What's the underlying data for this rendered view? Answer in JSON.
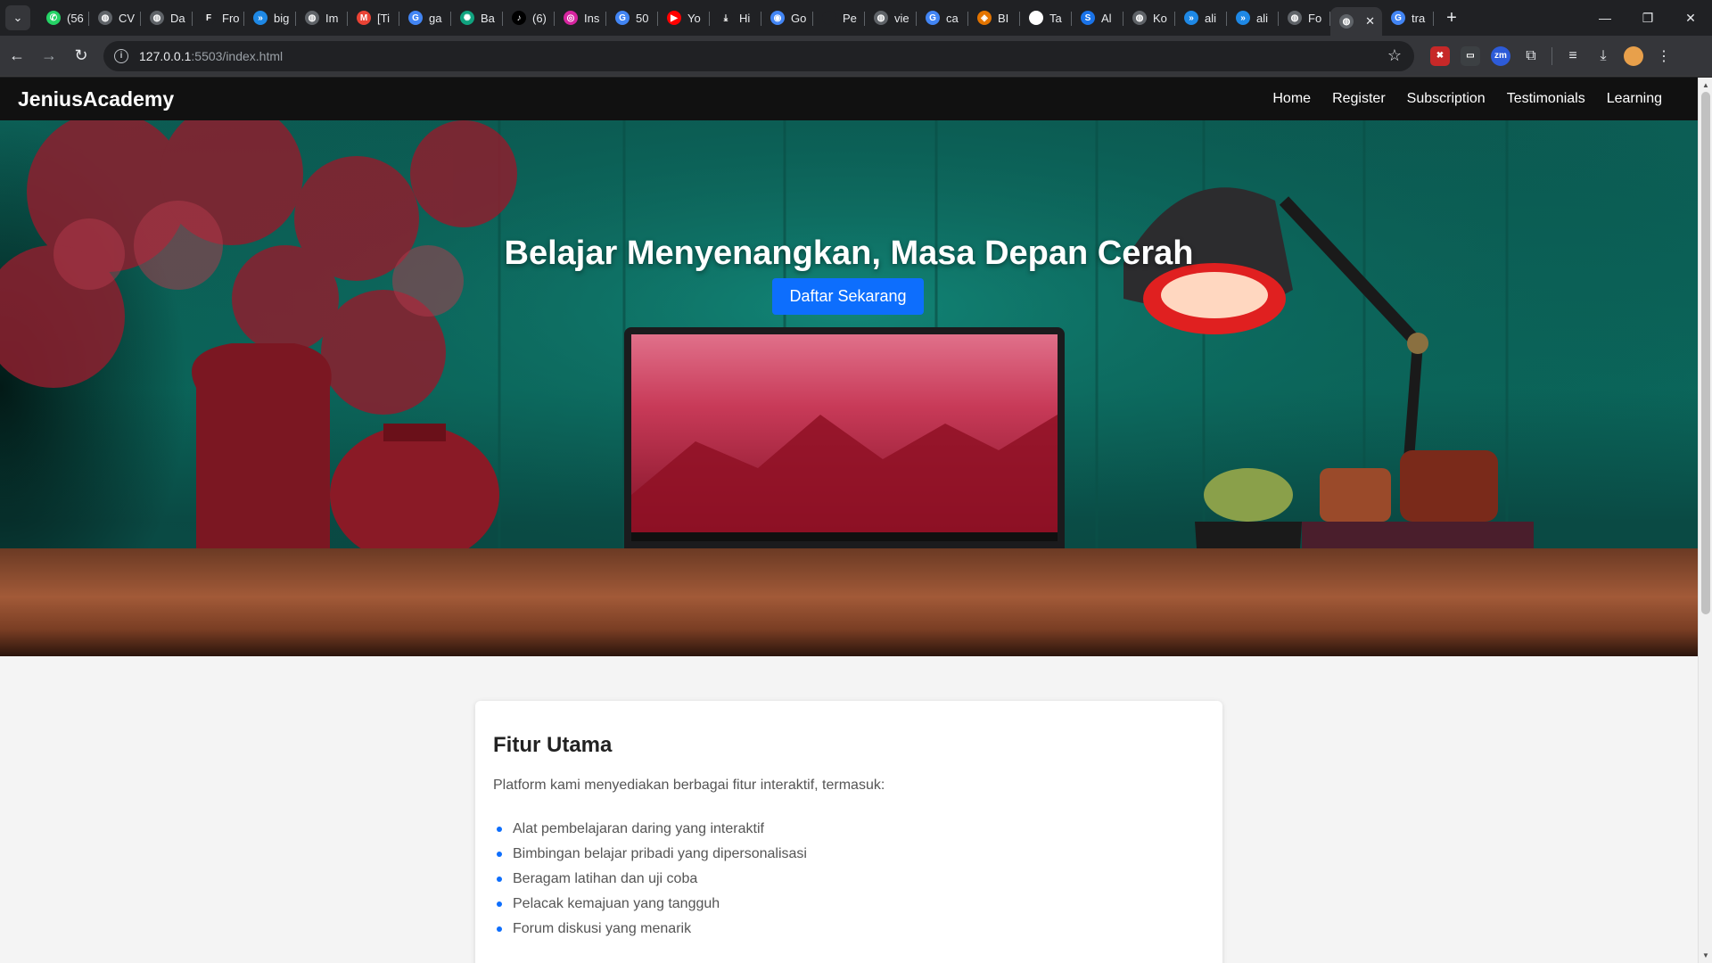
{
  "browser": {
    "tabs": [
      {
        "title": "(56",
        "icon": "whatsapp-icon",
        "color": "#25d366"
      },
      {
        "title": "CV",
        "icon": "globe-icon",
        "color": "#5f6368"
      },
      {
        "title": "Da",
        "icon": "globe-icon",
        "color": "#5f6368"
      },
      {
        "title": "Fro",
        "icon": "fr-icon",
        "color": "#202124"
      },
      {
        "title": "big",
        "icon": "codeium-icon",
        "color": "#1e88e5"
      },
      {
        "title": "Im",
        "icon": "globe-icon",
        "color": "#5f6368"
      },
      {
        "title": "[Ti",
        "icon": "gmail-icon",
        "color": "#ea4335"
      },
      {
        "title": "ga",
        "icon": "google-icon",
        "color": "#4285f4"
      },
      {
        "title": "Ba",
        "icon": "chatgpt-icon",
        "color": "#10a37f"
      },
      {
        "title": "(6)",
        "icon": "tiktok-icon",
        "color": "#000000"
      },
      {
        "title": "Ins",
        "icon": "instagram-icon",
        "color": "#d6249f"
      },
      {
        "title": "50",
        "icon": "google-icon",
        "color": "#4285f4"
      },
      {
        "title": "Yo",
        "icon": "youtube-icon",
        "color": "#ff0000"
      },
      {
        "title": "Hi",
        "icon": "download-icon",
        "color": "#202124"
      },
      {
        "title": "Go",
        "icon": "lens-icon",
        "color": "#4285f4"
      },
      {
        "title": "Pe",
        "icon": "blank-icon",
        "color": "#202124"
      },
      {
        "title": "vie",
        "icon": "globe-icon",
        "color": "#5f6368"
      },
      {
        "title": "ca",
        "icon": "google-icon",
        "color": "#4285f4"
      },
      {
        "title": "BI",
        "icon": "bi-icon",
        "color": "#e37400"
      },
      {
        "title": "Ta",
        "icon": "github-icon",
        "color": "#ffffff"
      },
      {
        "title": "Al",
        "icon": "shield-icon",
        "color": "#1a73e8"
      },
      {
        "title": "Ko",
        "icon": "globe-icon",
        "color": "#5f6368"
      },
      {
        "title": "ali",
        "icon": "codeium-icon",
        "color": "#1e88e5"
      },
      {
        "title": "ali",
        "icon": "codeium-icon",
        "color": "#1e88e5"
      },
      {
        "title": "Fo",
        "icon": "globe-icon",
        "color": "#5f6368"
      },
      {
        "title": "",
        "icon": "globe-icon",
        "color": "#5f6368",
        "active": true
      },
      {
        "title": "tra",
        "icon": "google-icon",
        "color": "#4285f4"
      }
    ],
    "url_host": "127.0.0.1",
    "url_rest": ":5503/index.html"
  },
  "site": {
    "brand": "JeniusAcademy",
    "nav": [
      "Home",
      "Register",
      "Subscription",
      "Testimonials",
      "Learning"
    ],
    "hero": {
      "title": "Belajar Menyenangkan, Masa Depan Cerah",
      "cta": "Daftar Sekarang"
    },
    "features": {
      "title": "Fitur Utama",
      "intro": "Platform kami menyediakan berbagai fitur interaktif, termasuk:",
      "items": [
        "Alat pembelajaran daring yang interaktif",
        "Bimbingan belajar pribadi yang dipersonalisasi",
        "Beragam latihan dan uji coba",
        "Pelacak kemajuan yang tangguh",
        "Forum diskusi yang menarik"
      ]
    }
  },
  "colors": {
    "nav_bg": "#111111",
    "cta": "#0d6efd",
    "hero_wall": "#0b6a5e"
  }
}
